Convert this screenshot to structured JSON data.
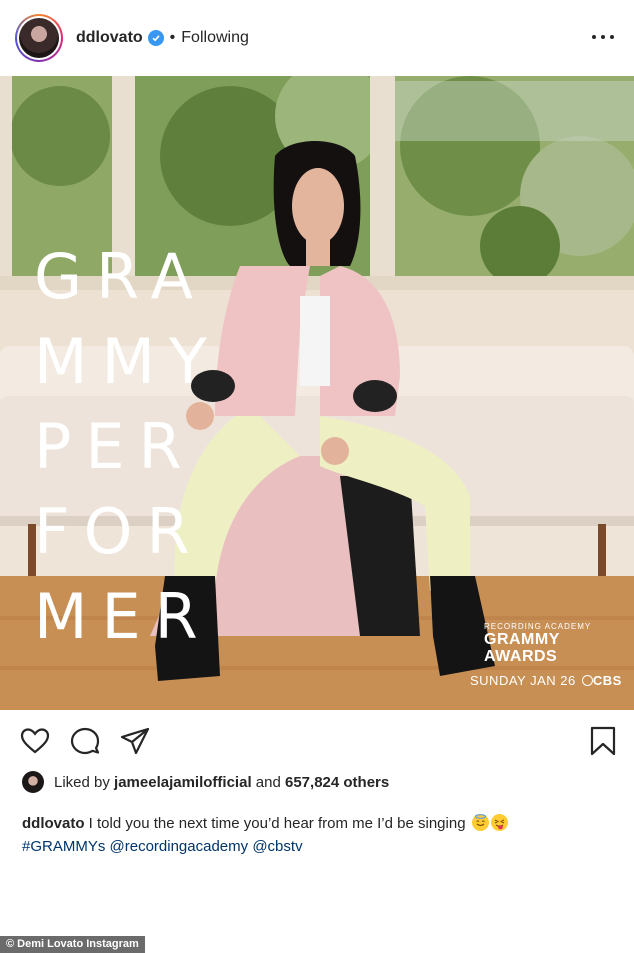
{
  "header": {
    "username": "ddlovato",
    "separator": "•",
    "follow_status": "Following"
  },
  "photo": {
    "overlay_lines": [
      "GRA",
      "MMY",
      "PER",
      "FOR",
      "MER"
    ],
    "logo": {
      "small": "RECORDING ACADEMY",
      "line1": "GRAMMY",
      "line2": "AWARDS",
      "date": "SUNDAY JAN 26",
      "network": "CBS"
    }
  },
  "actions": {
    "icons": [
      "heart-icon",
      "comment-icon",
      "share-icon",
      "bookmark-icon"
    ]
  },
  "likes": {
    "prefix": "Liked by",
    "liker": "jameelajamilofficial",
    "conj": "and",
    "others": "657,824 others"
  },
  "caption": {
    "username": "ddlovato",
    "text": "I told you the next time you’d hear from me I’d be singing",
    "hashtag": "#GRAMMYs",
    "mention1": "@recordingacademy",
    "mention2": "@cbstv"
  },
  "credit": "© Demi Lovato Instagram",
  "colors": {
    "verified": "#3897f0",
    "link": "#003569",
    "text": "#262626"
  }
}
